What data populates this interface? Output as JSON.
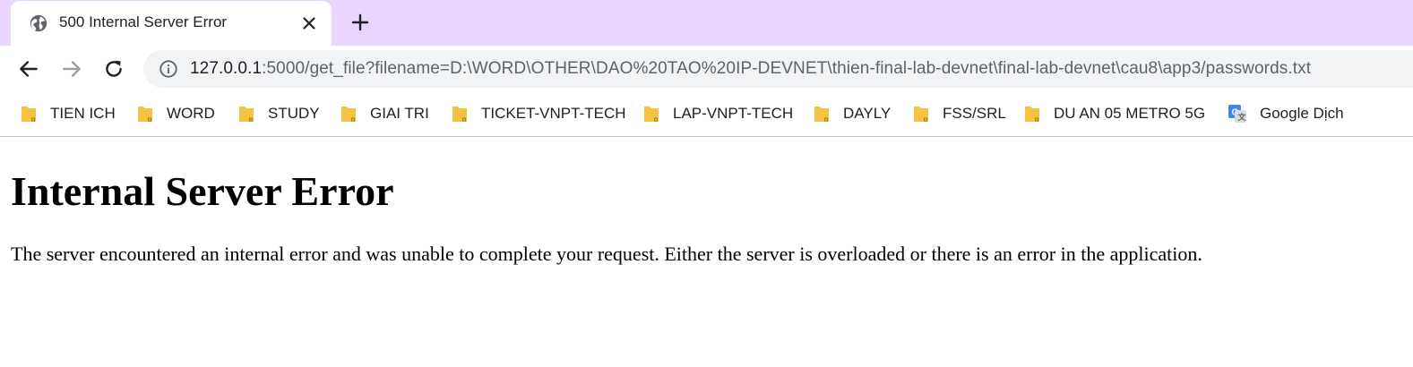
{
  "colors": {
    "tabstrip_bg": "#e9d5ff",
    "omnibox_bg": "#f1f3f4",
    "folder_yellow": "#f5c342",
    "text": "#202124",
    "muted": "#5f6368"
  },
  "tab": {
    "title": "500 Internal Server Error",
    "favicon": "globe-icon",
    "close_icon": "close-icon"
  },
  "new_tab_icon": "plus-icon",
  "toolbar": {
    "back_icon": "back-arrow-icon",
    "forward_icon": "forward-arrow-icon",
    "reload_icon": "reload-icon",
    "info_icon": "info-icon",
    "url_host": "127.0.0.1",
    "url_rest": ":5000/get_file?filename=D:\\WORD\\OTHER\\DAO%20TAO%20IP-DEVNET\\thien-final-lab-devnet\\final-lab-devnet\\cau8\\app3/passwords.txt"
  },
  "bookmarks": [
    {
      "label": "TIEN ICH",
      "icon": "folder-icon"
    },
    {
      "label": "WORD",
      "icon": "folder-icon"
    },
    {
      "label": "STUDY",
      "icon": "folder-icon"
    },
    {
      "label": "GIAI TRI",
      "icon": "folder-icon"
    },
    {
      "label": "TICKET-VNPT-TECH",
      "icon": "folder-icon"
    },
    {
      "label": "LAP-VNPT-TECH",
      "icon": "folder-icon"
    },
    {
      "label": "DAYLY",
      "icon": "folder-icon"
    },
    {
      "label": "FSS/SRL",
      "icon": "folder-icon"
    },
    {
      "label": "DU AN 05 METRO 5G",
      "icon": "folder-icon"
    },
    {
      "label": "Google Dịch",
      "icon": "google-translate-icon"
    }
  ],
  "page": {
    "heading": "Internal Server Error",
    "message": "The server encountered an internal error and was unable to complete your request. Either the server is overloaded or there is an error in the application."
  }
}
